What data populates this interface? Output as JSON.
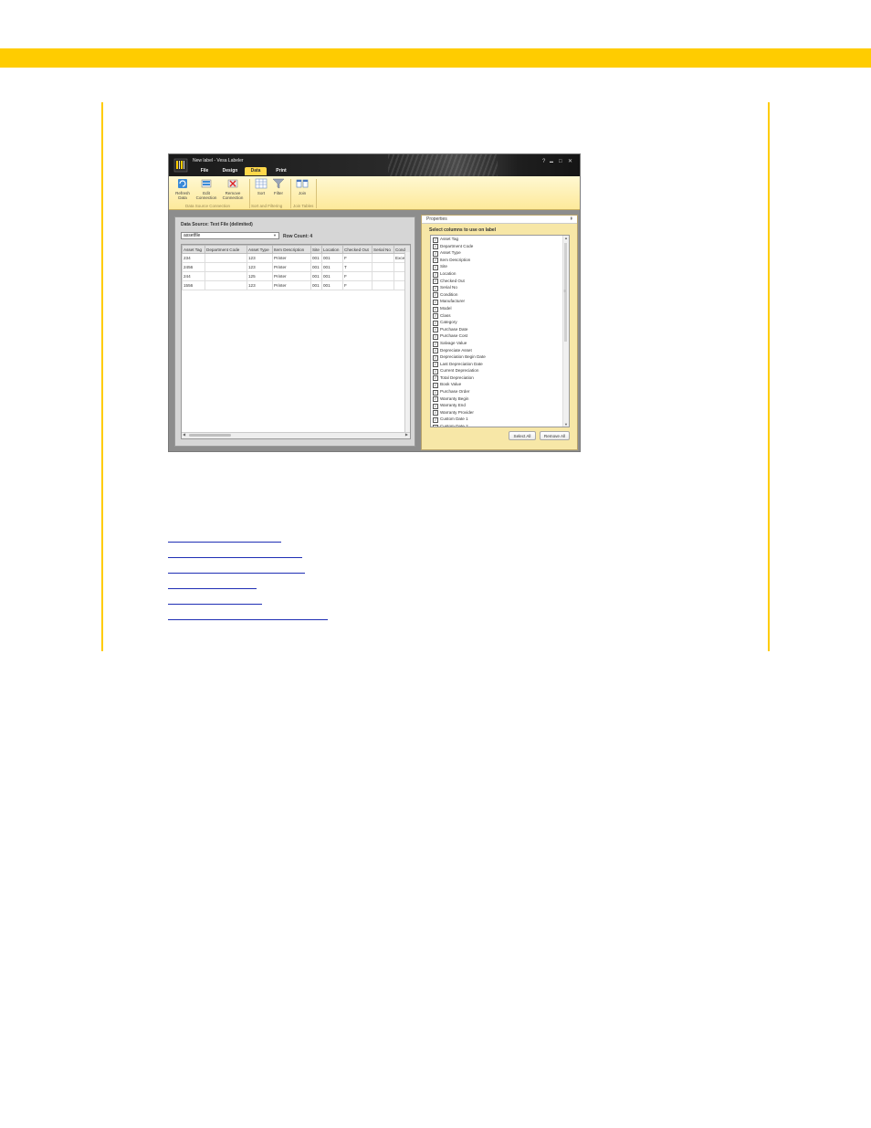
{
  "window": {
    "title": "New label - Vesa Labeler",
    "tabs": [
      "File",
      "Design",
      "Data",
      "Print"
    ],
    "active_tab": "Data",
    "controls": {
      "help": "?",
      "minimize": "▬",
      "maximize": "□",
      "close": "✕"
    }
  },
  "ribbon": {
    "refresh_label": "Refresh\nData",
    "edit_label": "Edit\nConnection",
    "remove_label": "Remove\nConnection",
    "sort_label": "Sort",
    "filter_label": "Filter",
    "join_label": "Join",
    "group_connection": "Data Source Connection",
    "group_sort": "Sort and Filtering",
    "group_join": "Join Tables"
  },
  "data_pane": {
    "source_label": "Data Source: Text File (delimited)",
    "selected_table": "assetfile",
    "row_count_label": "Row Count: 4",
    "columns": [
      "Asset Tag",
      "Department Code",
      "Asset Type",
      "Item Description",
      "Site",
      "Location",
      "Checked Out",
      "Serial No",
      "Cond"
    ],
    "rows": [
      [
        "234",
        "",
        "123",
        "Printer",
        "001",
        "001",
        "F",
        "",
        "Excell"
      ],
      [
        "2456",
        "",
        "123",
        "Printer",
        "001",
        "001",
        "T",
        "",
        ""
      ],
      [
        "244",
        "",
        "125",
        "Printer",
        "001",
        "001",
        "F",
        "",
        ""
      ],
      [
        "1556",
        "",
        "123",
        "Printer",
        "001",
        "001",
        "F",
        "",
        ""
      ]
    ]
  },
  "properties": {
    "header": "Properties",
    "pin": "⇞",
    "section_title": "Select columns to use on label",
    "checkmark": "✓",
    "items": [
      "Asset Tag",
      "Department Code",
      "Asset Type",
      "Item Description",
      "Site",
      "Location",
      "Checked Out",
      "Serial No",
      "Condition",
      "Manufacturer",
      "Model",
      "Class",
      "Category",
      "Purchase Date",
      "Purchase Cost",
      "Salvage Value",
      "Depreciate Asset",
      "Depreciation Begin Date",
      "Last Depreciation Date",
      "Current Depreciation",
      "Total Depreciation",
      "Book Value",
      "Purchase Order",
      "Warranty Begin",
      "Warranty End",
      "Warranty Provider",
      "Custom Date 1",
      "Custom Date 2"
    ],
    "select_all_label": "Select All",
    "remove_all_label": "Remove All"
  },
  "colors": {
    "accent": "#ffcc00",
    "link": "#1f2fb5",
    "ribbon": "#fde99a"
  },
  "link_widths": [
    124,
    147,
    150,
    97,
    103,
    175
  ]
}
